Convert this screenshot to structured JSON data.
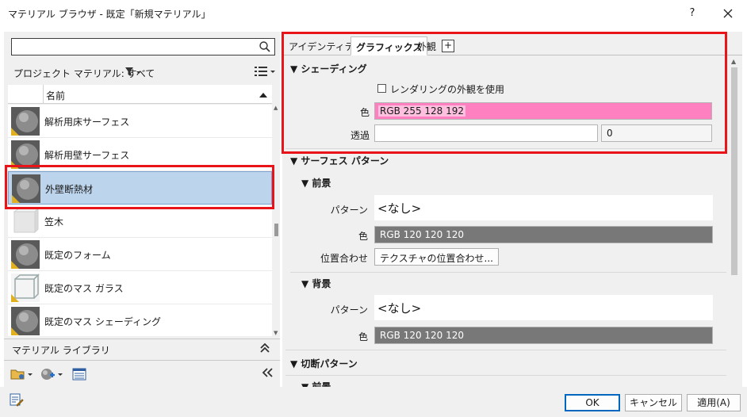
{
  "window": {
    "title": "マテリアル ブラウザ - 既定「新規マテリアル」",
    "help_label": "?"
  },
  "left": {
    "search": {
      "value": "",
      "placeholder": ""
    },
    "filter_label": "プロジェクト マテリアル: すべて",
    "column_header": "名前",
    "materials": [
      {
        "name": "解析用床サーフェス",
        "thumb": "sphere-gray"
      },
      {
        "name": "解析用壁サーフェス",
        "thumb": "sphere-gray"
      },
      {
        "name": "外壁断熱材",
        "thumb": "sphere-gray",
        "selected": true
      },
      {
        "name": "笠木",
        "thumb": "cube-light"
      },
      {
        "name": "既定のフォーム",
        "thumb": "sphere-gray"
      },
      {
        "name": "既定のマス ガラス",
        "thumb": "glass-box"
      },
      {
        "name": "既定のマス シェーディング",
        "thumb": "sphere-gray"
      }
    ],
    "library_label": "マテリアル ライブラリ"
  },
  "right": {
    "tabs": [
      {
        "label": "アイデンティティ",
        "active": false
      },
      {
        "label": "グラフィックス",
        "active": true
      },
      {
        "label": "外観",
        "active": false
      }
    ],
    "add_tab_label": "+",
    "shading": {
      "heading": "シェーディング",
      "use_render_appearance": "レンダリングの外観を使用",
      "color_label": "色",
      "color_value": "RGB 255 128 192",
      "color_hex": "#ff80c0",
      "transparency_label": "透過",
      "transparency_value": "0"
    },
    "surface_pattern": {
      "heading": "サーフェス パターン",
      "foreground": {
        "heading": "前景",
        "pattern_label": "パターン",
        "pattern_value": "<なし>",
        "color_label": "色",
        "color_value": "RGB 120 120 120",
        "color_hex": "#787878",
        "align_label": "位置合わせ",
        "align_button": "テクスチャの位置合わせ..."
      },
      "background": {
        "heading": "背景",
        "pattern_label": "パターン",
        "pattern_value": "<なし>",
        "color_label": "色",
        "color_value": "RGB 120 120 120",
        "color_hex": "#787878"
      }
    },
    "cut_pattern": {
      "heading": "切断パターン",
      "foreground_heading": "前景"
    }
  },
  "buttons": {
    "ok": "OK",
    "cancel": "キャンセル",
    "apply": "適用(A)"
  },
  "highlight_color": "#e8141a"
}
